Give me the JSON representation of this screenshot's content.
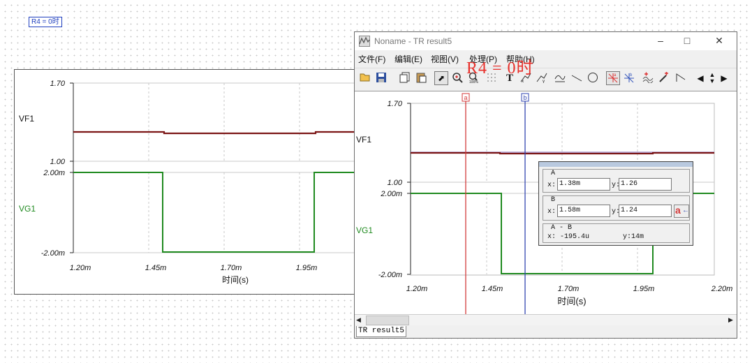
{
  "annotation_label": "R4 = 0时",
  "overlay_text": "R4 = 0时",
  "left_chart": {
    "sig1": "VF1",
    "sig2": "VG1",
    "y1_ticks": [
      "1.70",
      "1.00"
    ],
    "y2_ticks": [
      "2.00m",
      "-2.00m"
    ],
    "x_ticks": [
      "1.20m",
      "1.45m",
      "1.70m",
      "1.95m"
    ],
    "xlabel": "时间(s)"
  },
  "window": {
    "title": "Noname - TR result5",
    "menus": [
      "文件(F)",
      "编辑(E)",
      "视图(V)",
      "处理(P)",
      "帮助(H)"
    ],
    "tab_label": "TR result5",
    "colors": {
      "vf1": "#7b1515",
      "vg1": "#1f8a1f",
      "cursor_a": "#d33a3a",
      "cursor_b": "#3246b0"
    }
  },
  "right_chart": {
    "sig1": "VF1",
    "sig2": "VG1",
    "y1_ticks": [
      "1.70",
      "1.00"
    ],
    "y2_ticks": [
      "2.00m",
      "-2.00m"
    ],
    "x_ticks": [
      "1.20m",
      "1.45m",
      "1.70m",
      "1.95m",
      "2.20m"
    ],
    "xlabel": "时间(s)",
    "cursor_a_label": "a",
    "cursor_b_label": "b"
  },
  "cursor_readout": {
    "a_title": "A",
    "a_x_label": "x:",
    "a_x": "1.38m",
    "a_y_label": "y:",
    "a_y": "1.26",
    "b_title": "B",
    "b_x_label": "x:",
    "b_x": "1.58m",
    "b_y_label": "y:",
    "b_y": "1.24",
    "b_button": "a",
    "diff_title": "A - B",
    "diff_x": "x: -195.4u",
    "diff_y": "y:14m"
  }
}
